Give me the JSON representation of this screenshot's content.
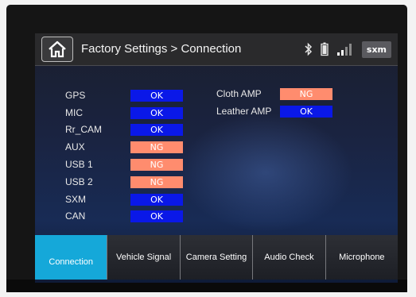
{
  "header": {
    "title": "Factory Settings > Connection",
    "icons": [
      "home-icon",
      "bluetooth-icon",
      "battery-icon",
      "signal-icon",
      "sxm-icon"
    ],
    "sxm_label": "sxm"
  },
  "left_status": [
    {
      "label": "GPS",
      "value": "OK"
    },
    {
      "label": "MIC",
      "value": "OK"
    },
    {
      "label": "Rr_CAM",
      "value": "OK"
    },
    {
      "label": "AUX",
      "value": "NG"
    },
    {
      "label": "USB 1",
      "value": "NG"
    },
    {
      "label": "USB 2",
      "value": "NG"
    },
    {
      "label": "SXM",
      "value": "OK"
    },
    {
      "label": "CAN",
      "value": "OK"
    }
  ],
  "right_status": [
    {
      "label": "Cloth AMP",
      "value": "NG"
    },
    {
      "label": "Leather AMP",
      "value": "OK"
    }
  ],
  "tabs": [
    {
      "label": "Connection",
      "active": true
    },
    {
      "label": "Vehicle Signal",
      "active": false
    },
    {
      "label": "Camera Setting",
      "active": false
    },
    {
      "label": "Audio Check",
      "active": false
    },
    {
      "label": "Microphone",
      "active": false
    }
  ],
  "colors": {
    "ok": "#0a18e8",
    "ng": "#ff8c6e",
    "active_tab": "#15a8d9"
  }
}
